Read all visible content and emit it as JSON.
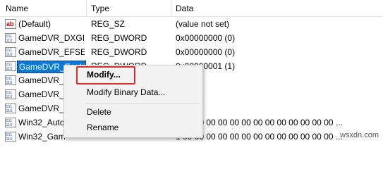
{
  "columns": {
    "name": "Name",
    "type": "Type",
    "data": "Data"
  },
  "rows": [
    {
      "name": "(Default)",
      "type": "REG_SZ",
      "data": "(value not set)",
      "icon": "string-value-icon"
    },
    {
      "name": "GameDVR_DXGI...",
      "type": "REG_DWORD",
      "data": "0x00000000 (0)",
      "icon": "binary-value-icon"
    },
    {
      "name": "GameDVR_EFSE...",
      "type": "REG_DWORD",
      "data": "0x00000000 (0)",
      "icon": "binary-value-icon"
    },
    {
      "name": "GameDVR_Enabl...",
      "type": "REG_DWORD",
      "data": "0x00000001 (1)",
      "icon": "binary-value-icon"
    },
    {
      "name": "GameDVR_F",
      "type": "",
      "data": "",
      "icon": "binary-value-icon"
    },
    {
      "name": "GameDVR_F",
      "type": "",
      "data": "",
      "icon": "binary-value-icon"
    },
    {
      "name": "GameDVR_H",
      "type": "",
      "data": "",
      "icon": "binary-value-icon"
    },
    {
      "name": "Win32_Auto",
      "type": "",
      "data": "1 00 00 00 00 00 00 00 00 00 00 00 00 00 ...",
      "icon": "binary-value-icon"
    },
    {
      "name": "Win32_Gam",
      "type": "",
      "data": "1 00 00 00 00 00 00 00 00 00 00 00 00 00 ...",
      "icon": "binary-value-icon"
    }
  ],
  "context_menu": {
    "modify": "Modify...",
    "modify_binary": "Modify Binary Data...",
    "delete": "Delete",
    "rename": "Rename"
  },
  "watermark": "wsxdn.com",
  "colors": {
    "selection": "#0078d7",
    "highlight_box": "#d32f2f",
    "menu_bg": "#f2f2f2"
  }
}
